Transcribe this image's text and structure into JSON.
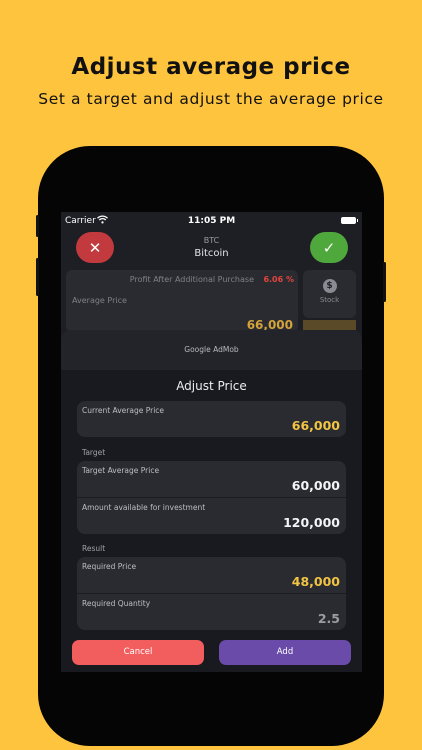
{
  "promo": {
    "title": "Adjust average price",
    "subtitle": "Set a target and adjust the average price"
  },
  "status_bar": {
    "carrier": "Carrier",
    "time": "11:05 PM"
  },
  "header": {
    "ticker": "BTC",
    "name": "Bitcoin",
    "close_icon": "✕",
    "confirm_icon": "✓"
  },
  "background_card": {
    "profit_label": "Profit After Additional Purchase",
    "profit_value": "6.06 %",
    "average_price_label": "Average Price",
    "average_price_value": "66,000"
  },
  "stock_tab": {
    "icon": "$",
    "label": "Stock"
  },
  "ad": {
    "label": "Google AdMob"
  },
  "sheet": {
    "title": "Adjust Price",
    "current": {
      "label": "Current Average Price",
      "value": "66,000"
    },
    "target_section": "Target",
    "target": {
      "average_label": "Target Average Price",
      "average_value": "60,000",
      "amount_label": "Amount available for investment",
      "amount_value": "120,000"
    },
    "result_section": "Result",
    "result": {
      "price_label": "Required Price",
      "price_value": "48,000",
      "quantity_label": "Required Quantity",
      "quantity_value": "2.5"
    },
    "cancel_label": "Cancel",
    "add_label": "Add"
  },
  "colors": {
    "background": "#FFC43D",
    "gold_value": "#F2C443",
    "cancel": "#F25D5D",
    "add": "#6A4BAA",
    "close": "#C23A3E",
    "confirm": "#4FA83B"
  }
}
